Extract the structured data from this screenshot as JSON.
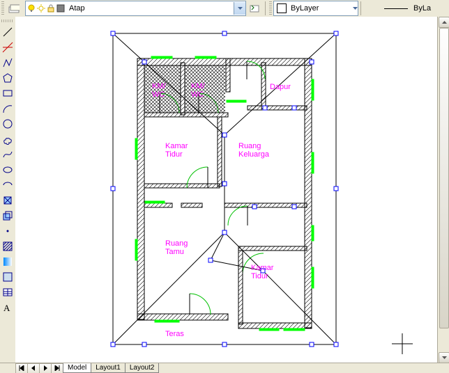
{
  "topbar": {
    "layer": "Atap",
    "color": "ByLayer",
    "linetype": "ByLa"
  },
  "rooms": {
    "km1": "KM/\nWC",
    "km2": "KM/\nWC",
    "dapur": "Dapur",
    "kamar1": "Kamar\nTidur",
    "ruang_keluarga": "Ruang\nKeluarga",
    "ruang_tamu": "Ruang\nTamu",
    "kamar2": "Kamar\nTidur",
    "teras": "Teras"
  },
  "tabs": {
    "model": "Model",
    "layout1": "Layout1",
    "layout2": "Layout2"
  }
}
